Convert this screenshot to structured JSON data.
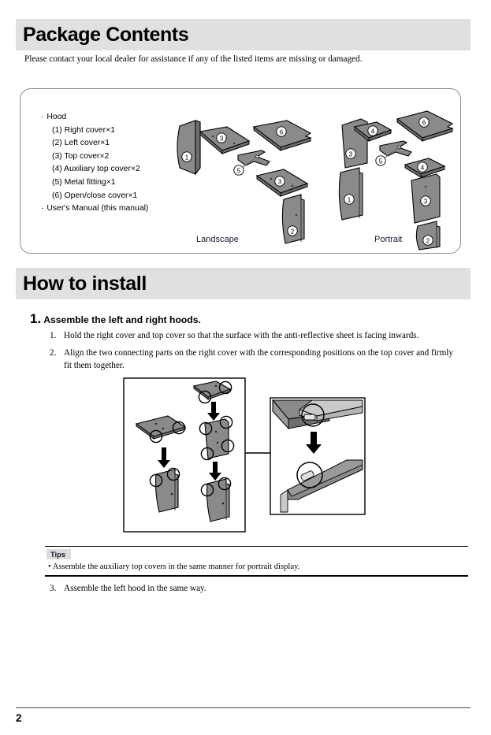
{
  "headings": {
    "package_contents": "Package Contents",
    "how_to_install": "How to install"
  },
  "intro": "Please contact your local dealer for assistance if any of the listed items are missing or damaged.",
  "parts_list": {
    "group_label": "Hood",
    "items": [
      "(1) Right cover×1",
      "(2) Left cover×1",
      "(3) Top cover×2",
      "(4) Auxiliary top cover×2",
      "(5) Metal fitting×1",
      "(6) Open/close cover×1"
    ],
    "manual_label": "User's Manual (this manual)"
  },
  "diagram": {
    "landscape_label": "Landscape",
    "portrait_label": "Portrait",
    "landscape_parts": [
      "1",
      "3",
      "6",
      "5",
      "3",
      "2"
    ],
    "portrait_parts": [
      "3",
      "4",
      "6",
      "5",
      "4",
      "1",
      "3",
      "2"
    ]
  },
  "install": {
    "step_number": "1.",
    "step_title": "Assemble the left and right hoods.",
    "substeps": [
      {
        "n": "1.",
        "text": "Hold the right cover and top cover so that the surface with the anti-reflective sheet is facing inwards."
      },
      {
        "n": "2.",
        "text": "Align the two connecting parts on the right cover with the corresponding positions on the top cover and firmly fit them together."
      }
    ],
    "step3": {
      "n": "3.",
      "text": "Assemble the left hood in the same way."
    }
  },
  "tips": {
    "label": "Tips",
    "bullet": "• Assemble the auxiliary top covers in the same manner for portrait display."
  },
  "footer": {
    "page_number": "2"
  },
  "colors": {
    "band": "#e0e0e0",
    "panel_border": "#8c8c8c",
    "part_fill": "#8a8a8a",
    "part_fill_dark": "#6e6e6e",
    "part_fill_light": "#c9c9c9",
    "outline": "#000000",
    "label_text": "#1a1a33"
  }
}
